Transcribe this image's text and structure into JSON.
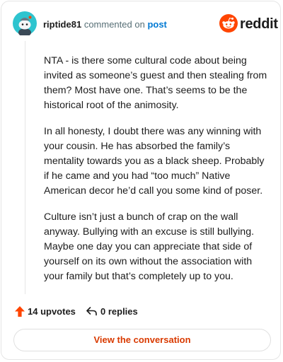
{
  "header": {
    "username": "riptide81",
    "action_text": "commented on",
    "post_link": "post",
    "brand": "reddit"
  },
  "comment": {
    "paragraphs": [
      "NTA - is there some cultural code about being invited as someone’s guest and then stealing from them? Most have one. That’s seems to be the historical root of the animosity.",
      "In all honesty, I doubt there was any winning with your cousin. He has absorbed the family’s mentality towards you as a black sheep. Probably if he came and you had “too much” Native American decor he’d call you some kind of poser.",
      "Culture isn’t just a bunch of crap on the wall anyway. Bullying with an excuse is still bullying. Maybe one day you can appreciate that side of yourself on its own without the association with your family but that’s completely up to you."
    ]
  },
  "actions": {
    "upvotes": "14 upvotes",
    "replies": "0 replies"
  },
  "cta": {
    "label": "View the conversation"
  },
  "colors": {
    "brand_orange": "#ff4500",
    "link_blue": "#0079d3",
    "cta_text": "#d93a00",
    "avatar_bg": "#2ec4cf"
  },
  "icons": [
    "avatar-icon",
    "reddit-logo-icon",
    "upvote-icon",
    "reply-icon"
  ]
}
